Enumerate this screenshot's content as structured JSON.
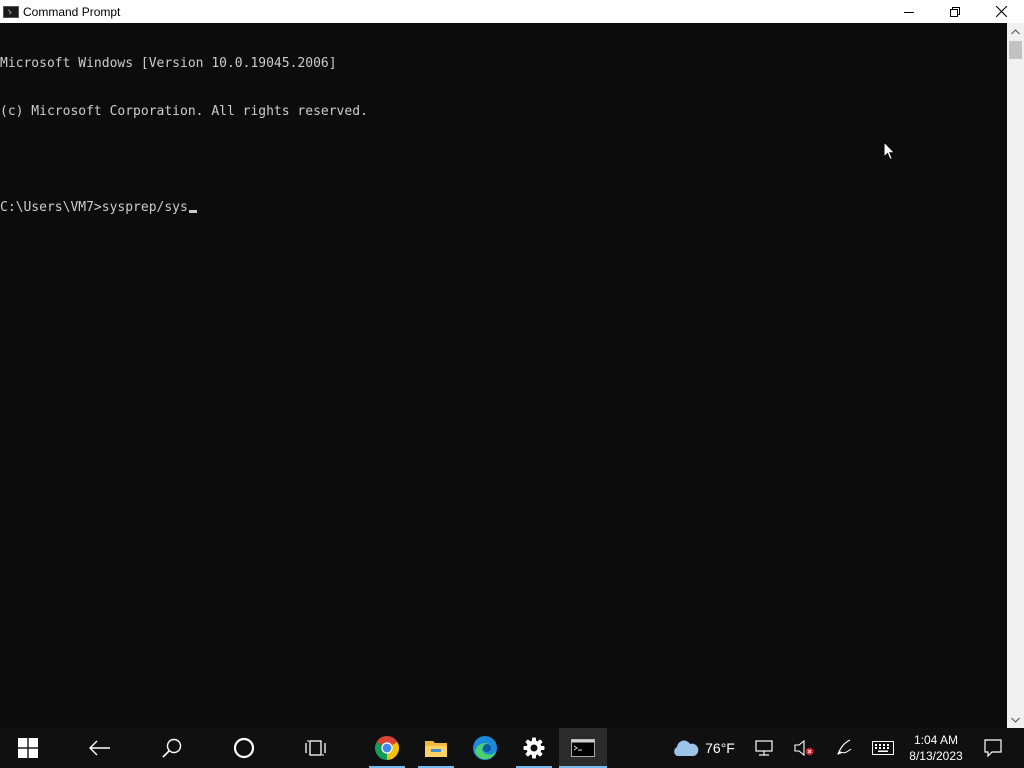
{
  "window": {
    "title": "Command Prompt",
    "icon": "cmd-icon"
  },
  "console": {
    "lines": [
      "Microsoft Windows [Version 10.0.19045.2006]",
      "(c) Microsoft Corporation. All rights reserved.",
      "",
      "C:\\Users\\VM7>sysprep/sys"
    ]
  },
  "taskbar": {
    "weather_temp": "76°F",
    "clock_time": "1:04 AM",
    "clock_date": "8/13/2023",
    "apps": [
      "start",
      "back",
      "search",
      "cortana",
      "task-view",
      "chrome",
      "file-explorer",
      "edge",
      "settings",
      "command-prompt"
    ],
    "active_app": "command-prompt"
  },
  "colors": {
    "console_bg": "#0c0c0c",
    "console_fg": "#cccccc",
    "taskbar_bg": "#101010",
    "accent": "#76b9ed"
  }
}
